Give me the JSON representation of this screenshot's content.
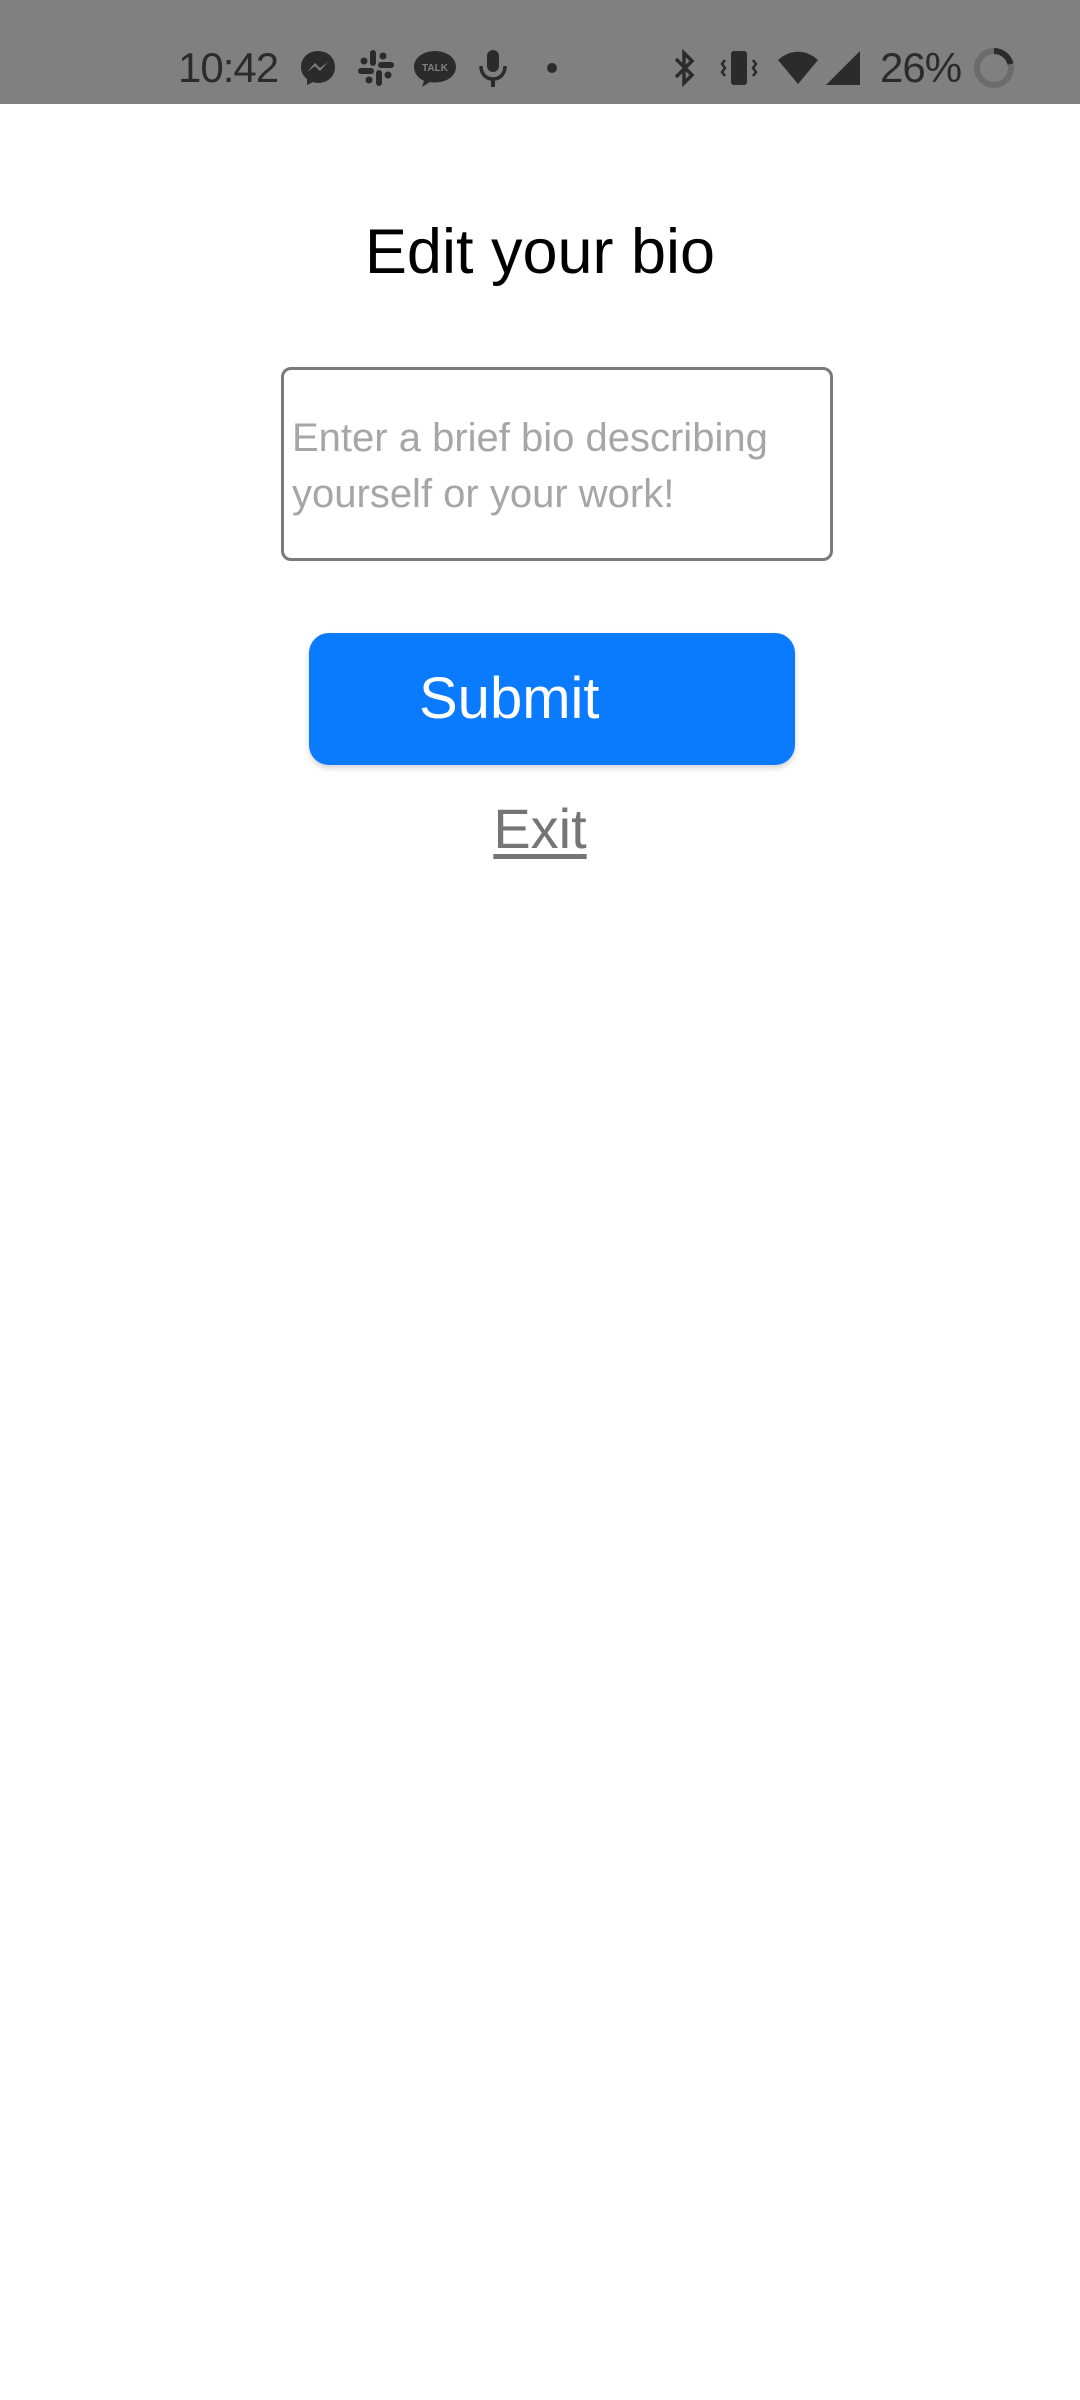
{
  "status_bar": {
    "time": "10:42",
    "battery_percent": "26%",
    "left_icons": [
      "messenger-icon",
      "slack-icon",
      "kakaotalk-icon",
      "microphone-icon",
      "dot-icon"
    ],
    "right_icons": [
      "bluetooth-icon",
      "vibrate-icon",
      "wifi-icon",
      "cellular-signal-icon",
      "battery-ring-icon"
    ],
    "talk_icon_text": "TALK"
  },
  "page": {
    "title": "Edit your bio"
  },
  "bio_input": {
    "value": "",
    "placeholder": "Enter a brief bio describing yourself or your work!"
  },
  "actions": {
    "submit_label": "Submit",
    "exit_label": "Exit"
  },
  "colors": {
    "status_bar_bg": "#808080",
    "submit_bg": "#0a7aff",
    "exit_link": "#757575",
    "placeholder": "#a6a6a6"
  }
}
